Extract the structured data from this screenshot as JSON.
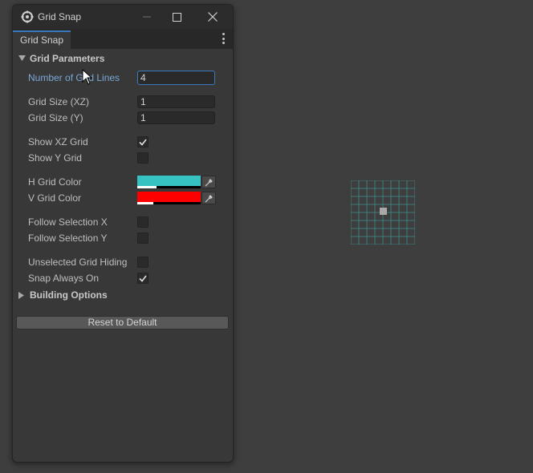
{
  "window": {
    "title": "Grid Snap",
    "tab_label": "Grid Snap"
  },
  "sections": {
    "grid_parameters": "Grid Parameters",
    "building_options": "Building Options"
  },
  "fields": {
    "number_of_grid_lines": {
      "label": "Number of Grid Lines",
      "value": "4"
    },
    "grid_size_xz": {
      "label": "Grid Size (XZ)",
      "value": "1"
    },
    "grid_size_y": {
      "label": "Grid Size (Y)",
      "value": "1"
    },
    "show_xz_grid": {
      "label": "Show XZ Grid",
      "checked": true
    },
    "show_y_grid": {
      "label": "Show Y Grid",
      "checked": false
    },
    "h_grid_color": {
      "label": "H Grid Color",
      "color": "#36c2c0"
    },
    "v_grid_color": {
      "label": "V Grid Color",
      "color": "#ff0000"
    },
    "follow_selection_x": {
      "label": "Follow Selection X",
      "checked": false
    },
    "follow_selection_y": {
      "label": "Follow Selection Y",
      "checked": false
    },
    "unselected_grid_hiding": {
      "label": "Unselected Grid Hiding",
      "checked": false
    },
    "snap_always_on": {
      "label": "Snap Always On",
      "checked": true
    }
  },
  "buttons": {
    "reset": "Reset to Default"
  },
  "colors": {
    "accent": "#3a79bb",
    "scene_background": "#3e3e3e",
    "grid_line": "#3f9e9c"
  }
}
